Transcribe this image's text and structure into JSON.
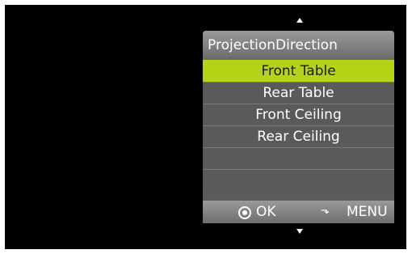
{
  "menu": {
    "title": "ProjectionDirection",
    "items": [
      {
        "label": "Front Table",
        "selected": true
      },
      {
        "label": "Rear Table",
        "selected": false
      },
      {
        "label": "Front Ceiling",
        "selected": false
      },
      {
        "label": "Rear Ceiling",
        "selected": false
      },
      {
        "label": "",
        "selected": false
      },
      {
        "label": "",
        "selected": false
      }
    ]
  },
  "footer": {
    "ok_label": "OK",
    "menu_label": "MENU"
  },
  "icons": {
    "scroll_up": "up-arrow-icon",
    "scroll_down": "down-arrow-icon",
    "ok": "ok-circle-icon",
    "back": "return-arrow-icon"
  },
  "colors": {
    "selection": "#b6d316",
    "panel": "#5a5a5a",
    "background": "#000000"
  }
}
